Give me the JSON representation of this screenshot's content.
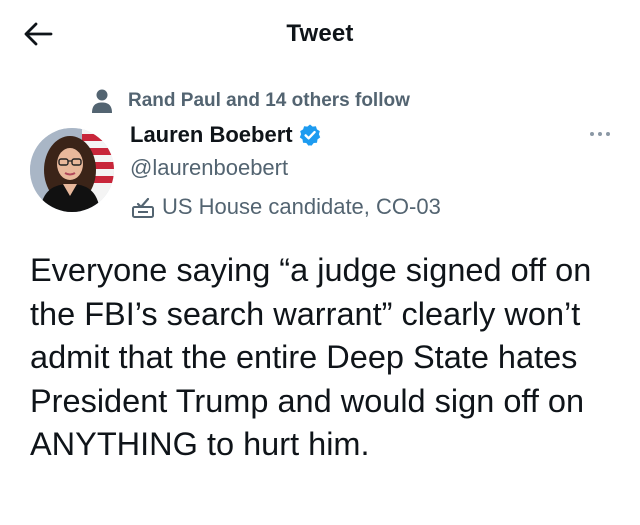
{
  "header": {
    "title": "Tweet",
    "back_icon": "arrow-left-icon"
  },
  "social_context": {
    "icon": "person-icon",
    "text": "Rand Paul and 14 others follow"
  },
  "author": {
    "name": "Lauren Boebert",
    "verified": true,
    "handle": "@laurenboebert",
    "label_icon": "ballot-box-icon",
    "label": "US House candidate, CO-03"
  },
  "more_icon": "more-horizontal-icon",
  "tweet": {
    "text": "Everyone saying “a judge signed off on the FBI’s search warrant” clearly won’t admit that the entire Deep State hates President Trump and would sign off on ANYTHING to hurt him."
  },
  "colors": {
    "text_primary": "#0f1419",
    "text_secondary": "#536471",
    "verified_blue": "#1d9bf0"
  }
}
